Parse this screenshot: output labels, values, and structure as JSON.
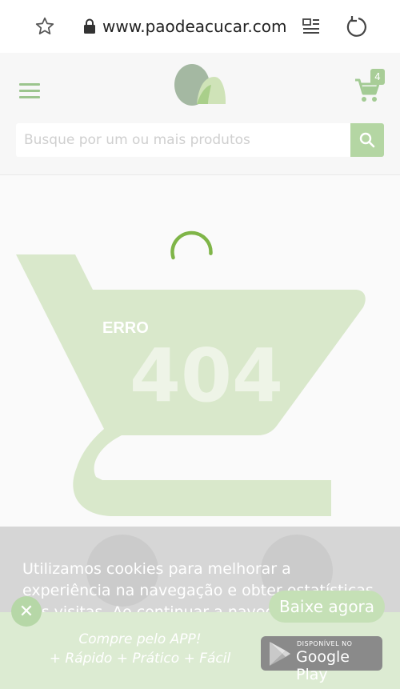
{
  "browser": {
    "url": "www.paodeacucar.com"
  },
  "header": {
    "cart_count": "4",
    "search_placeholder": "Busque por um ou mais produtos"
  },
  "error": {
    "label": "ERRO",
    "code": "404"
  },
  "cookie": {
    "text": "Utilizamos cookies para melhorar a experiência na navegação e obter estatísticas das visitas. Ao continuar a navegação você aceita"
  },
  "app_banner": {
    "line1": "Compre pelo APP!",
    "line2": "+ Rápido + Prático + Fácil",
    "download_button": "Baixe agora",
    "store_small": "DISPONÍVEL NO",
    "store_name": "Google Play"
  },
  "colors": {
    "brand_green": "#9cc58e",
    "accent_green": "#7fb548"
  }
}
